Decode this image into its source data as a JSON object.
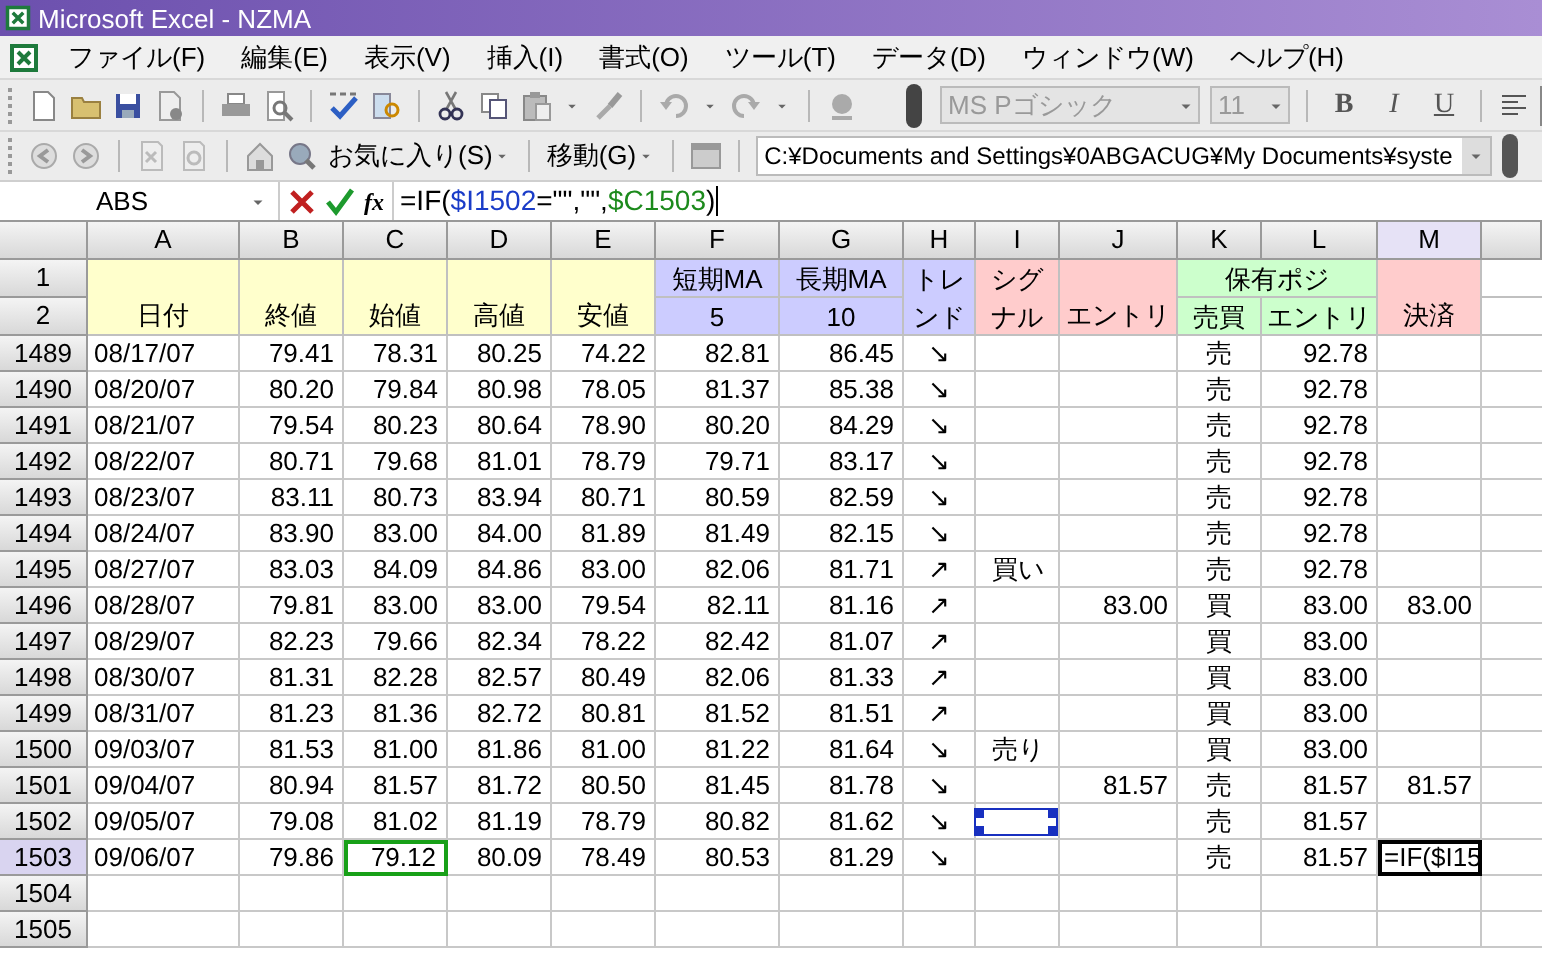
{
  "window": {
    "title": "Microsoft Excel - NZMA"
  },
  "menu": [
    "ファイル(F)",
    "編集(E)",
    "表示(V)",
    "挿入(I)",
    "書式(O)",
    "ツール(T)",
    "データ(D)",
    "ウィンドウ(W)",
    "ヘルプ(H)"
  ],
  "formatting_toolbar": {
    "font": "MS Pゴシック",
    "size": "11",
    "style_buttons": [
      "B",
      "I",
      "U"
    ]
  },
  "web_toolbar": {
    "favorites": "お気に入り(S)",
    "go": "移動(G)",
    "address": "C:¥Documents and Settings¥0ABGACUG¥My Documents¥syste"
  },
  "formula_bar": {
    "name_box": "ABS",
    "function_button": "fx",
    "formula": [
      {
        "text": "=IF(",
        "color": "#000000"
      },
      {
        "text": "$I1502",
        "color": "#1a3cc8"
      },
      {
        "text": "=\"\",\"\",",
        "color": "#000000"
      },
      {
        "text": "$C1503",
        "color": "#1c8a1c"
      },
      {
        "text": ")",
        "color": "#000000"
      }
    ]
  },
  "columns": [
    {
      "letter": "A",
      "selected": false
    },
    {
      "letter": "B",
      "selected": false
    },
    {
      "letter": "C",
      "selected": false
    },
    {
      "letter": "D",
      "selected": false
    },
    {
      "letter": "E",
      "selected": false
    },
    {
      "letter": "F",
      "selected": false
    },
    {
      "letter": "G",
      "selected": false
    },
    {
      "letter": "H",
      "selected": false
    },
    {
      "letter": "I",
      "selected": false
    },
    {
      "letter": "J",
      "selected": false
    },
    {
      "letter": "K",
      "selected": false
    },
    {
      "letter": "L",
      "selected": false
    },
    {
      "letter": "M",
      "selected": true
    }
  ],
  "header_row_labels": [
    "1",
    "2"
  ],
  "header_cells": [
    {
      "kind": "upper",
      "text": "短期MA",
      "color": "#ccccff"
    },
    {
      "kind": "upper",
      "text": "長期MA",
      "color": "#ccccff"
    },
    {
      "kind": "wrap",
      "text": "トレンド",
      "color": "#ccccff"
    },
    {
      "kind": "wrap",
      "text": "シグナル",
      "color": "#ffcccc"
    },
    {
      "kind": "group",
      "text": "保有ポジ",
      "color": "#ccffcc"
    },
    {
      "kind": "tall",
      "text": "日付",
      "color": "#ffffcc"
    },
    {
      "kind": "tall",
      "text": "終値",
      "color": "#ffffcc"
    },
    {
      "kind": "tall",
      "text": "始値",
      "color": "#ffffcc"
    },
    {
      "kind": "tall",
      "text": "高値",
      "color": "#ffffcc"
    },
    {
      "kind": "tall",
      "text": "安値",
      "color": "#ffffcc"
    },
    {
      "kind": "lower",
      "text": "5",
      "color": "#ccccff"
    },
    {
      "kind": "lower",
      "text": "10",
      "color": "#ccccff"
    },
    {
      "kind": "tall",
      "text": "エントリ",
      "color": "#ffcccc"
    },
    {
      "kind": "lower",
      "text": "売買",
      "color": "#ccffcc"
    },
    {
      "kind": "lower",
      "text": "エントリ",
      "color": "#ccffcc"
    },
    {
      "kind": "tall",
      "text": "決済",
      "color": "#ffcccc"
    }
  ],
  "rows": [
    {
      "label": "1489",
      "selected": false,
      "cells": [
        "08/17/07",
        "79.41",
        "78.31",
        "80.25",
        "74.22",
        "82.81",
        "86.45",
        "↘",
        null,
        null,
        "売",
        "92.78",
        null
      ]
    },
    {
      "label": "1490",
      "selected": false,
      "cells": [
        "08/20/07",
        "80.20",
        "79.84",
        "80.98",
        "78.05",
        "81.37",
        "85.38",
        "↘",
        null,
        null,
        "売",
        "92.78",
        null
      ]
    },
    {
      "label": "1491",
      "selected": false,
      "cells": [
        "08/21/07",
        "79.54",
        "80.23",
        "80.64",
        "78.90",
        "80.20",
        "84.29",
        "↘",
        null,
        null,
        "売",
        "92.78",
        null
      ]
    },
    {
      "label": "1492",
      "selected": false,
      "cells": [
        "08/22/07",
        "80.71",
        "79.68",
        "81.01",
        "78.79",
        "79.71",
        "83.17",
        "↘",
        null,
        null,
        "売",
        "92.78",
        null
      ]
    },
    {
      "label": "1493",
      "selected": false,
      "cells": [
        "08/23/07",
        "83.11",
        "80.73",
        "83.94",
        "80.71",
        "80.59",
        "82.59",
        "↘",
        null,
        null,
        "売",
        "92.78",
        null
      ]
    },
    {
      "label": "1494",
      "selected": false,
      "cells": [
        "08/24/07",
        "83.90",
        "83.00",
        "84.00",
        "81.89",
        "81.49",
        "82.15",
        "↘",
        null,
        null,
        "売",
        "92.78",
        null
      ]
    },
    {
      "label": "1495",
      "selected": false,
      "cells": [
        "08/27/07",
        "83.03",
        "84.09",
        "84.86",
        "83.00",
        "82.06",
        "81.71",
        "↗",
        "買い",
        null,
        "売",
        "92.78",
        null
      ]
    },
    {
      "label": "1496",
      "selected": false,
      "cells": [
        "08/28/07",
        "79.81",
        "83.00",
        "83.00",
        "79.54",
        "82.11",
        "81.16",
        "↗",
        null,
        "83.00",
        "買",
        "83.00",
        "83.00"
      ]
    },
    {
      "label": "1497",
      "selected": false,
      "cells": [
        "08/29/07",
        "82.23",
        "79.66",
        "82.34",
        "78.22",
        "82.42",
        "81.07",
        "↗",
        null,
        null,
        "買",
        "83.00",
        null
      ]
    },
    {
      "label": "1498",
      "selected": false,
      "cells": [
        "08/30/07",
        "81.31",
        "82.28",
        "82.57",
        "80.49",
        "82.06",
        "81.33",
        "↗",
        null,
        null,
        "買",
        "83.00",
        null
      ]
    },
    {
      "label": "1499",
      "selected": false,
      "cells": [
        "08/31/07",
        "81.23",
        "81.36",
        "82.72",
        "80.81",
        "81.52",
        "81.51",
        "↗",
        null,
        null,
        "買",
        "83.00",
        null
      ]
    },
    {
      "label": "1500",
      "selected": false,
      "cells": [
        "09/03/07",
        "81.53",
        "81.00",
        "81.86",
        "81.00",
        "81.22",
        "81.64",
        "↘",
        "売り",
        null,
        "買",
        "83.00",
        null
      ]
    },
    {
      "label": "1501",
      "selected": false,
      "cells": [
        "09/04/07",
        "80.94",
        "81.57",
        "81.72",
        "80.50",
        "81.45",
        "81.78",
        "↘",
        null,
        "81.57",
        "売",
        "81.57",
        "81.57"
      ]
    },
    {
      "label": "1502",
      "selected": false,
      "cells": [
        "09/05/07",
        "79.08",
        "81.02",
        "81.19",
        "78.79",
        "80.82",
        "81.62",
        "↘",
        {
          "shape_selected": true
        },
        null,
        "売",
        "81.57",
        null
      ]
    },
    {
      "label": "1503",
      "selected": true,
      "cells": [
        "09/06/07",
        "79.86",
        {
          "text": "79.12",
          "referenced": true
        },
        "80.09",
        "78.49",
        "80.53",
        "81.29",
        "↘",
        null,
        null,
        "売",
        "81.57",
        {
          "text": "=IF($I15",
          "editing": true
        }
      ]
    },
    {
      "label": "1504",
      "selected": false,
      "cells": [
        null,
        null,
        null,
        null,
        null,
        null,
        null,
        null,
        null,
        null,
        null,
        null,
        null
      ]
    },
    {
      "label": "1505",
      "selected": false,
      "cells": [
        null,
        null,
        null,
        null,
        null,
        null,
        null,
        null,
        null,
        null,
        null,
        null,
        null
      ]
    }
  ]
}
